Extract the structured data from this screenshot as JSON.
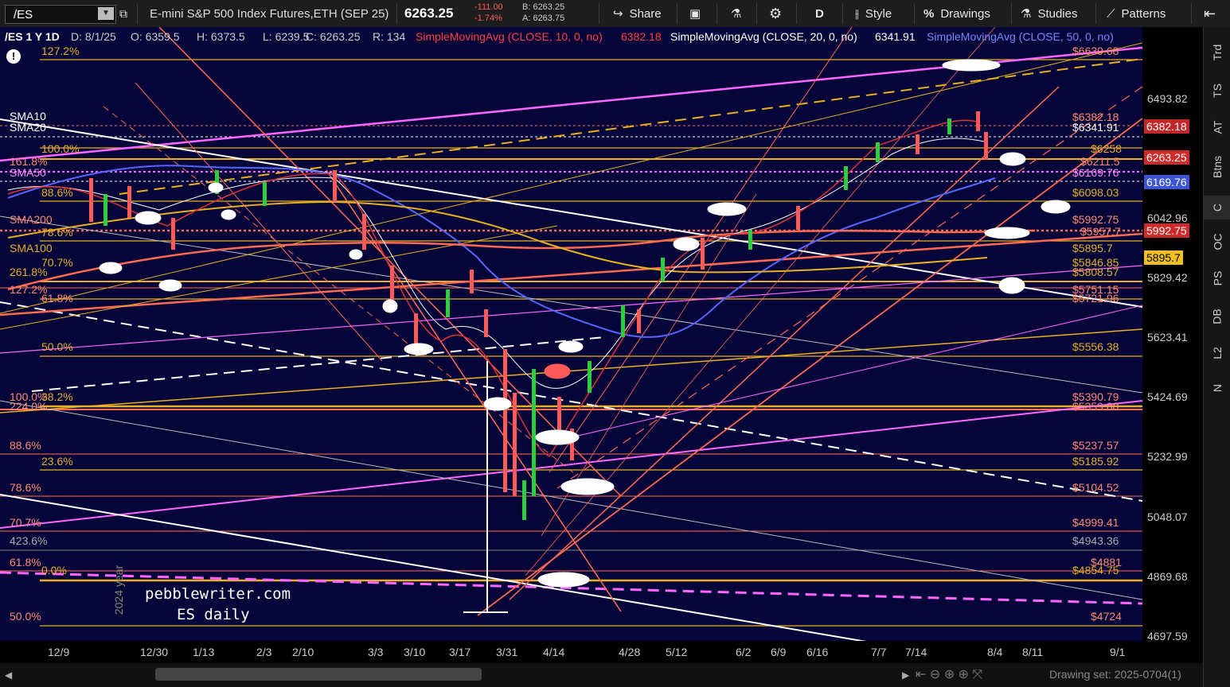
{
  "toolbar": {
    "symbol": "/ES",
    "description": "E-mini S&P 500 Index Futures,ETH (SEP 25)",
    "last_price": "6263.25",
    "change": "-111.00",
    "change_pct": "-1.74%",
    "bid": "B: 6263.25",
    "ask": "A: 6263.75",
    "share_label": "Share",
    "period_label": "D",
    "style_label": "Style",
    "drawings_label": "Drawings",
    "studies_label": "Studies",
    "patterns_label": "Patterns"
  },
  "info": {
    "ticker_tf": "/ES 1 Y 1D",
    "date": "D: 8/1/25",
    "open": "O: 6359.5",
    "high": "H: 6373.5",
    "low": "L: 6239.5",
    "close": "C: 6263.25",
    "range": "R: 134",
    "sma10_label": "SimpleMovingAvg (CLOSE, 10, 0, no)",
    "sma10_value": "6382.18",
    "sma20_label": "SimpleMovingAvg (CLOSE, 20, 0, no)",
    "sma20_value": "6341.91",
    "sma50_label": "SimpleMovingAvg (CLOSE, 50, 0, no)"
  },
  "y_axis": {
    "ticks": [
      "6493.82",
      "6042.96",
      "5829.42",
      "5623.41",
      "5424.69",
      "5232.99",
      "5048.07",
      "4869.68",
      "4697.59"
    ],
    "badges": [
      {
        "value": "6382.18",
        "bg": "#c0262a",
        "fg": "#ffffff"
      },
      {
        "value": "6263.25",
        "bg": "#d12a2a",
        "fg": "#ffffff"
      },
      {
        "value": "6169.76",
        "bg": "#3b55d6",
        "fg": "#ffffff"
      },
      {
        "value": "5992.75",
        "bg": "#d12a2a",
        "fg": "#ffffff"
      },
      {
        "value": "5895.7",
        "bg": "#f0c020",
        "fg": "#000000"
      }
    ]
  },
  "x_axis": {
    "ticks": [
      "12/9",
      "12/30",
      "1/13",
      "2/3",
      "2/10",
      "3/3",
      "3/10",
      "3/17",
      "3/31",
      "4/14",
      "4/28",
      "5/12",
      "6/2",
      "6/9",
      "6/16",
      "7/7",
      "7/14",
      "8/4",
      "8/11",
      "9/1"
    ]
  },
  "level_labels": {
    "right": [
      "$6639.68",
      "$6382.18",
      "$6341.91",
      "$6258",
      "$6211.5",
      "$6169.76",
      "$6098.03",
      "$5992.75",
      "$5957.7",
      "$5895.7",
      "$5846.85",
      "$5808.57",
      "$5751.15",
      "$5721.96",
      "$5556.38",
      "$5390.79",
      "$5359.88",
      "$5237.57",
      "$5185.92",
      "$5104.52",
      "$4999.41",
      "$4943.36",
      "$4881",
      "$4854.75",
      "$4724"
    ],
    "left": [
      "127.2%",
      "SMA10",
      "SMA20",
      "100.0%",
      "161.8%",
      "SMA50",
      "88.6%",
      "SMA200",
      "78.6%",
      "SMA100",
      "70.7%",
      "261.8%",
      "127.2%",
      "61.8%",
      "50.0%",
      "100.0%",
      "38.2%",
      "224.0%",
      "88.6%",
      "23.6%",
      "78.6%",
      "70.7%",
      "423.6%",
      "61.8%",
      "0.0%",
      "50.0%"
    ]
  },
  "watermark": {
    "line1": "pebblewriter.com",
    "line2": "ES daily",
    "year": "2024 year"
  },
  "sidebar": {
    "buttons": [
      "Trd",
      "TS",
      "AT",
      "Btns",
      "C",
      "OC",
      "PS",
      "DB",
      "L2",
      "N"
    ]
  },
  "footer": {
    "drawing_set": "Drawing set: 2025-0704(1)"
  },
  "colors": {
    "background": "#05053a",
    "toolbar": "#1d1d1d",
    "sma10": "#d33",
    "sma20": "#ffffff",
    "sma50": "#5566ff",
    "fib": "#e8b020",
    "pink": "#ff66ff",
    "salmon": "#ff6a50"
  }
}
